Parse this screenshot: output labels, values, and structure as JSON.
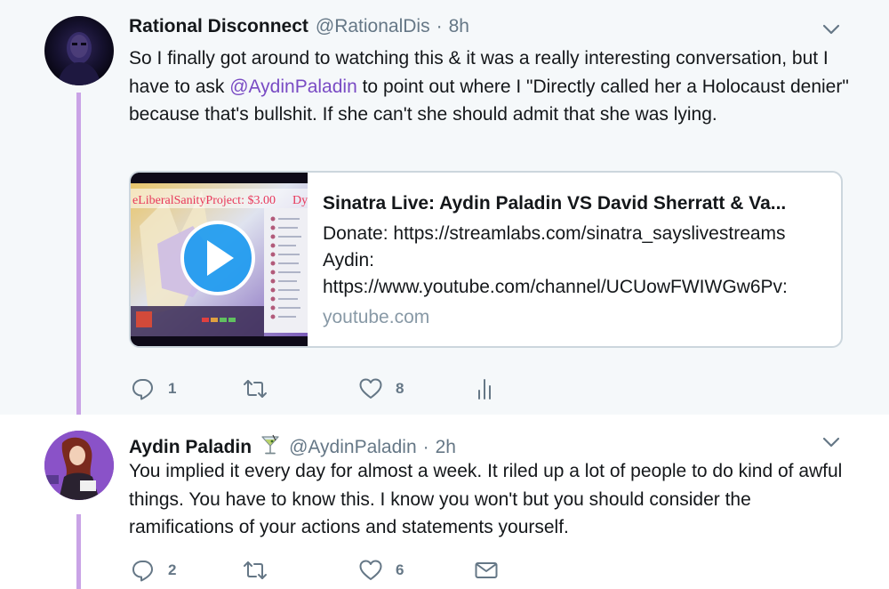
{
  "tweets": [
    {
      "author_name": "Rational Disconnect",
      "author_handle": "@RationalDis",
      "separator": "·",
      "time": "8h",
      "text_before_mention": "So I finally got around to watching this & it was a really interesting conversation, but I have to ask ",
      "mention": "@AydinPaladin",
      "text_after_mention": " to point out where I \"Directly called her a Holocaust denier\" because that's bullshit. If she can't she should admit that she was lying.",
      "card": {
        "title": "Sinatra Live: Aydin Paladin VS David Sherratt & Va...",
        "desc_line1": "Donate: https://streamlabs.com/sinatra_sayslivestreams",
        "desc_line2": "Aydin:",
        "desc_line3": "https://www.youtube.com/channel/UCUowFWIWGw6Pv:",
        "domain": "youtube.com",
        "thumb_overlay_text": "eLiberalSanityProject: $3.00",
        "thumb_overlay_suffix": "Dy"
      },
      "replies": "1",
      "likes": "8"
    },
    {
      "author_name": "Aydin Paladin",
      "author_handle": "@AydinPaladin",
      "separator": "·",
      "time": "2h",
      "name_emoji": "cocktail-glass-icon",
      "text": "You implied it every day for almost a week. It riled up a lot of people to do kind of awful things. You have to know this. I know you won't but you should consider the ramifications of your actions and statements yourself.",
      "replies": "2",
      "likes": "6"
    }
  ],
  "colors": {
    "thread_line": "#c9a3e6",
    "mention": "#794bc4",
    "secondary_text": "#657786",
    "icon": "#657786",
    "card_border": "#ccd6dd",
    "top_background": "#f5f8fa"
  }
}
